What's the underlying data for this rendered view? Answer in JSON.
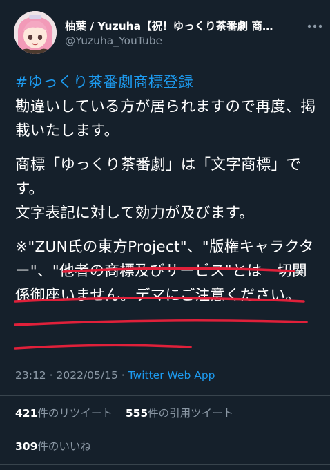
{
  "author": {
    "display_name": "柚葉 / Yuzuha【祝！ゆっくり茶番劇 商…",
    "handle": "@Yuzuha_YouTube",
    "avatar_icon": "character-avatar"
  },
  "tweet": {
    "hashtag": "#ゆっくり茶番劇商標登録",
    "para1": "勘違いしている方が居られますので再度、掲載いたします。",
    "para2a": "商標「ゆっくり茶番劇」は「文字商標」です。",
    "para2b": "文字表記に対して効力が及びます。",
    "para3": "※\"ZUN氏の東方Project\"、\"版権キャラクター\"、\"他者の商標及びサービス\"とは一切関係御座いません。デマにご注意ください。"
  },
  "meta": {
    "time": "23:12",
    "date": "2022/05/15",
    "separator": "·",
    "app": "Twitter Web App"
  },
  "stats": {
    "retweets_count": "421",
    "retweets_label": "件のリツイート",
    "quotes_count": "555",
    "quotes_label": "件の引用ツイート",
    "likes_count": "309",
    "likes_label": "件のいいね"
  },
  "colors": {
    "background": "#15202b",
    "accent": "#1d9bf0",
    "secondary_text": "#8b98a5",
    "underline": "#e0203a"
  }
}
